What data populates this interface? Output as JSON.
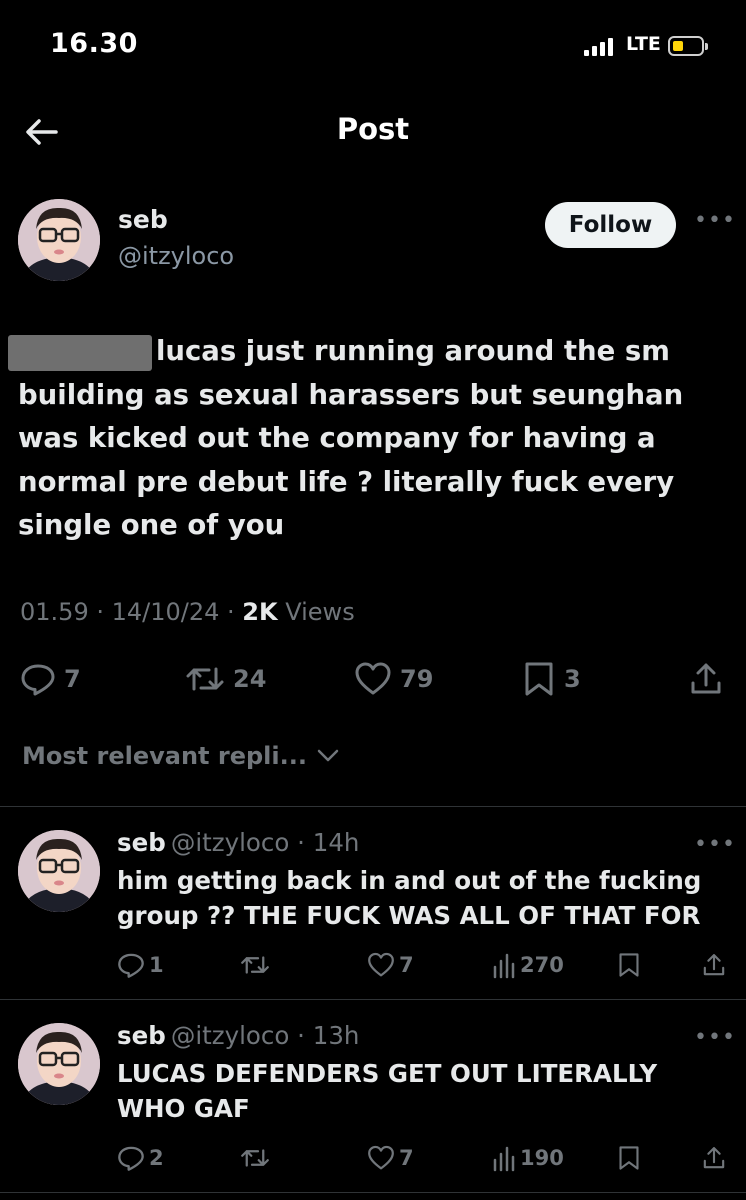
{
  "status_bar": {
    "time": "16.30",
    "network": "LTE",
    "battery_level": 0.35,
    "battery_color": "#ffd60a"
  },
  "header": {
    "title": "Post",
    "back_icon": "arrow-left-icon"
  },
  "post": {
    "author_name": "seb",
    "author_handle": "@itzyloco",
    "follow_label": "Follow",
    "more_icon": "ellipsis-icon",
    "text": "lucas just running around the sm building as sexual harassers but seunghan was kicked out the company for having a normal pre debut life ? literally fuck every single one of you",
    "meta_time": "01.59",
    "meta_date": "14/10/24",
    "meta_views_count": "2K",
    "meta_views_label": "Views",
    "actions": {
      "replies": "7",
      "reposts": "24",
      "likes": "79",
      "bookmarks": "3"
    }
  },
  "sort": {
    "label": "Most relevant repli..."
  },
  "replies": [
    {
      "name": "seb",
      "handle": "@itzyloco",
      "time": "14h",
      "text": "him getting back in and out of the fucking group ?? THE FUCK WAS ALL OF THAT FOR",
      "replies": "1",
      "likes": "7",
      "views": "270"
    },
    {
      "name": "seb",
      "handle": "@itzyloco",
      "time": "13h",
      "text": "LUCAS DEFENDERS GET OUT LITERALLY WHO GAF",
      "replies": "2",
      "likes": "7",
      "views": "190"
    }
  ],
  "colors": {
    "background": "#000000",
    "text": "#e7e9ea",
    "secondary": "#71767b",
    "divider": "#2f3336",
    "follow_bg": "#eff3f4"
  }
}
